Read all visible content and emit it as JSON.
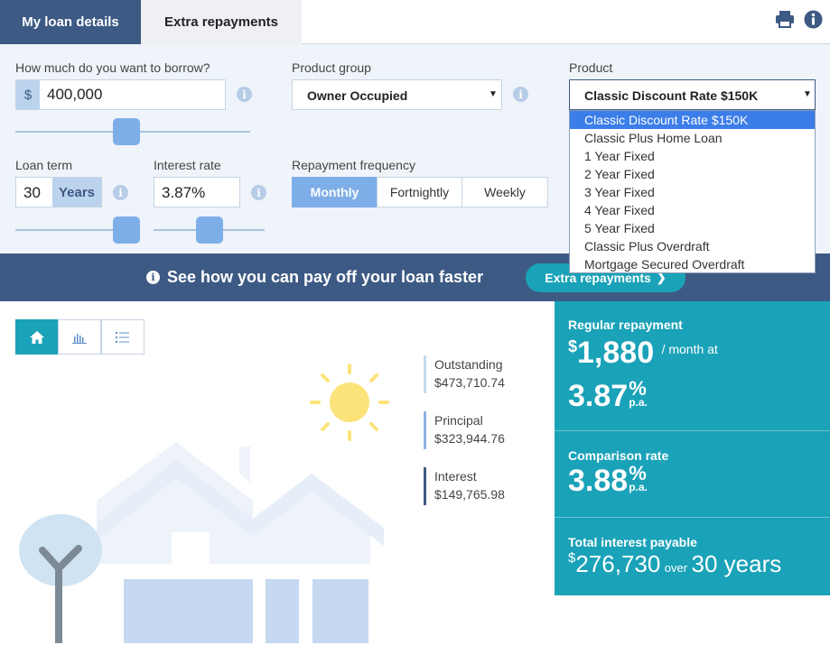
{
  "tabs": [
    {
      "label": "My loan details",
      "active": true
    },
    {
      "label": "Extra repayments",
      "active": false
    }
  ],
  "toolbar": {
    "print_icon": "print-icon",
    "info_icon": "info-icon"
  },
  "borrow": {
    "label": "How much do you want to borrow?",
    "prefix": "$",
    "value": "400,000",
    "slider_position": 0.52
  },
  "product_group": {
    "label": "Product group",
    "value": "Owner Occupied"
  },
  "product": {
    "label": "Product",
    "value": "Classic Discount Rate $150K",
    "options": [
      "Classic Discount Rate $150K",
      "Classic Plus Home Loan",
      "1 Year Fixed",
      "2 Year Fixed",
      "3 Year Fixed",
      "4 Year Fixed",
      "5 Year Fixed",
      "Classic Plus Overdraft",
      "Mortgage Secured Overdraft"
    ],
    "selected_index": 0
  },
  "loan_term": {
    "label": "Loan term",
    "value": "30",
    "unit": "Years",
    "slider_position": 1.0
  },
  "interest_rate": {
    "label": "Interest rate",
    "value": "3.87%",
    "slider_position": 0.5
  },
  "repayment_frequency": {
    "label": "Repayment frequency",
    "options": [
      "Monthly",
      "Fortnightly",
      "Weekly"
    ],
    "selected": "Monthly"
  },
  "banner": {
    "text": "See how you can pay off your loan faster",
    "button": "Extra repayments"
  },
  "view_toggles": [
    "home-icon",
    "bar-chart-icon",
    "list-icon"
  ],
  "legend": [
    {
      "label": "Outstanding",
      "value": "$473,710.74",
      "color": "#c5d9f1"
    },
    {
      "label": "Principal",
      "value": "$323,944.76",
      "color": "#8fb4e3"
    },
    {
      "label": "Interest",
      "value": "$149,765.98",
      "color": "#3d5a84"
    }
  ],
  "results": {
    "regular_repayment": {
      "title": "Regular repayment",
      "currency": "$",
      "amount": "1,880",
      "suffix": "/ month at",
      "rate": "3.87",
      "rate_unit": "%",
      "rate_suffix": "p.a."
    },
    "comparison_rate": {
      "title": "Comparison rate",
      "rate": "3.88",
      "rate_unit": "%",
      "rate_suffix": "p.a."
    },
    "total_interest": {
      "title": "Total interest payable",
      "currency": "$",
      "amount": "276,730",
      "over": "over",
      "term": "30 years"
    }
  },
  "colors": {
    "navy": "#3d5a84",
    "teal": "#1aa2b8",
    "light_blue": "#7eaee8",
    "form_bg": "#eff4fa",
    "sun": "#fbe37a"
  }
}
